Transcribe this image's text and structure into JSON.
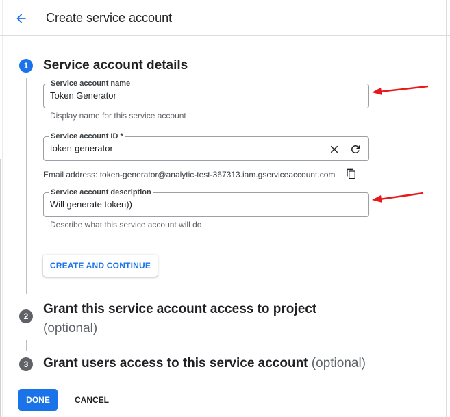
{
  "header": {
    "title": "Create service account"
  },
  "steps": [
    {
      "number": "1",
      "title": "Service account details"
    },
    {
      "number": "2",
      "title": "Grant this service account access to project",
      "optional": "(optional)"
    },
    {
      "number": "3",
      "title": "Grant users access to this service account",
      "optional": "(optional)"
    }
  ],
  "form": {
    "name": {
      "label": "Service account name",
      "value": "Token Generator",
      "helper": "Display name for this service account"
    },
    "id": {
      "label": "Service account ID *",
      "value": "token-generator"
    },
    "email_line": "Email address: token-generator@analytic-test-367313.iam.gserviceaccount.com",
    "description": {
      "label": "Service account description",
      "value": "Will generate token))",
      "helper": "Describe what this service account will do"
    }
  },
  "buttons": {
    "create_continue": "CREATE AND CONTINUE",
    "done": "DONE",
    "cancel": "CANCEL"
  },
  "colors": {
    "accent": "#1a73e8",
    "annotation_arrow": "#e8191c",
    "inactive_step": "#5f6368"
  },
  "icons": [
    "back-arrow-icon",
    "clear-icon",
    "refresh-icon",
    "copy-icon"
  ]
}
